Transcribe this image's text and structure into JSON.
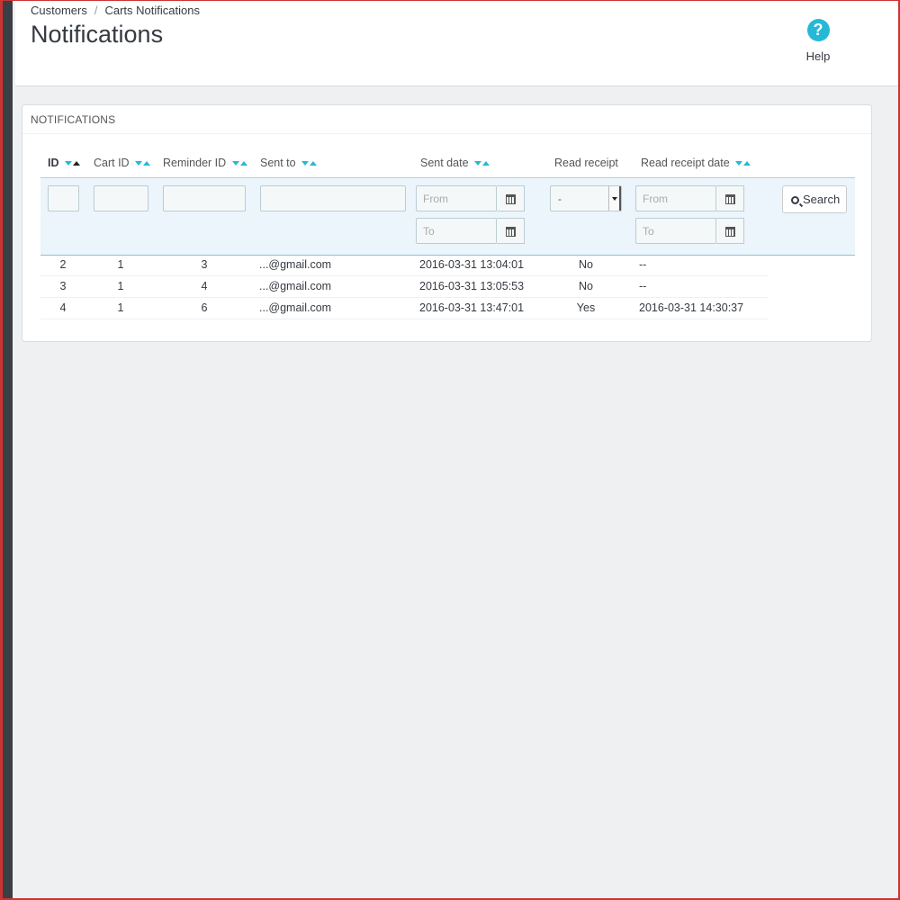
{
  "breadcrumb": {
    "parent": "Customers",
    "separator": "/",
    "current": "Carts Notifications"
  },
  "page_title": "Notifications",
  "help": {
    "label": "Help",
    "icon": "question-circle-icon"
  },
  "panel": {
    "heading": "Notifications"
  },
  "table": {
    "columns": [
      "ID",
      "Cart ID",
      "Reminder ID",
      "Sent to",
      "Sent date",
      "Read receipt",
      "Read receipt date"
    ],
    "filters": {
      "sent_date_from_placeholder": "From",
      "sent_date_to_placeholder": "To",
      "read_receipt_selected": "-",
      "read_receipt_date_from_placeholder": "From",
      "read_receipt_date_to_placeholder": "To"
    },
    "search_label": "Search",
    "rows": [
      {
        "id": "2",
        "cart_id": "1",
        "reminder_id": "3",
        "sent_to": "...@gmail.com",
        "sent_date": "2016-03-31 13:04:01",
        "read_receipt": "No",
        "read_receipt_date": "--"
      },
      {
        "id": "3",
        "cart_id": "1",
        "reminder_id": "4",
        "sent_to": "...@gmail.com",
        "sent_date": "2016-03-31 13:05:53",
        "read_receipt": "No",
        "read_receipt_date": "--"
      },
      {
        "id": "4",
        "cart_id": "1",
        "reminder_id": "6",
        "sent_to": "...@gmail.com",
        "sent_date": "2016-03-31 13:47:01",
        "read_receipt": "Yes",
        "read_receipt_date": "2016-03-31 14:30:37"
      }
    ]
  },
  "colors": {
    "accent": "#25b9d7",
    "filter_bg": "#ebf5fb",
    "text": "#363a41"
  }
}
